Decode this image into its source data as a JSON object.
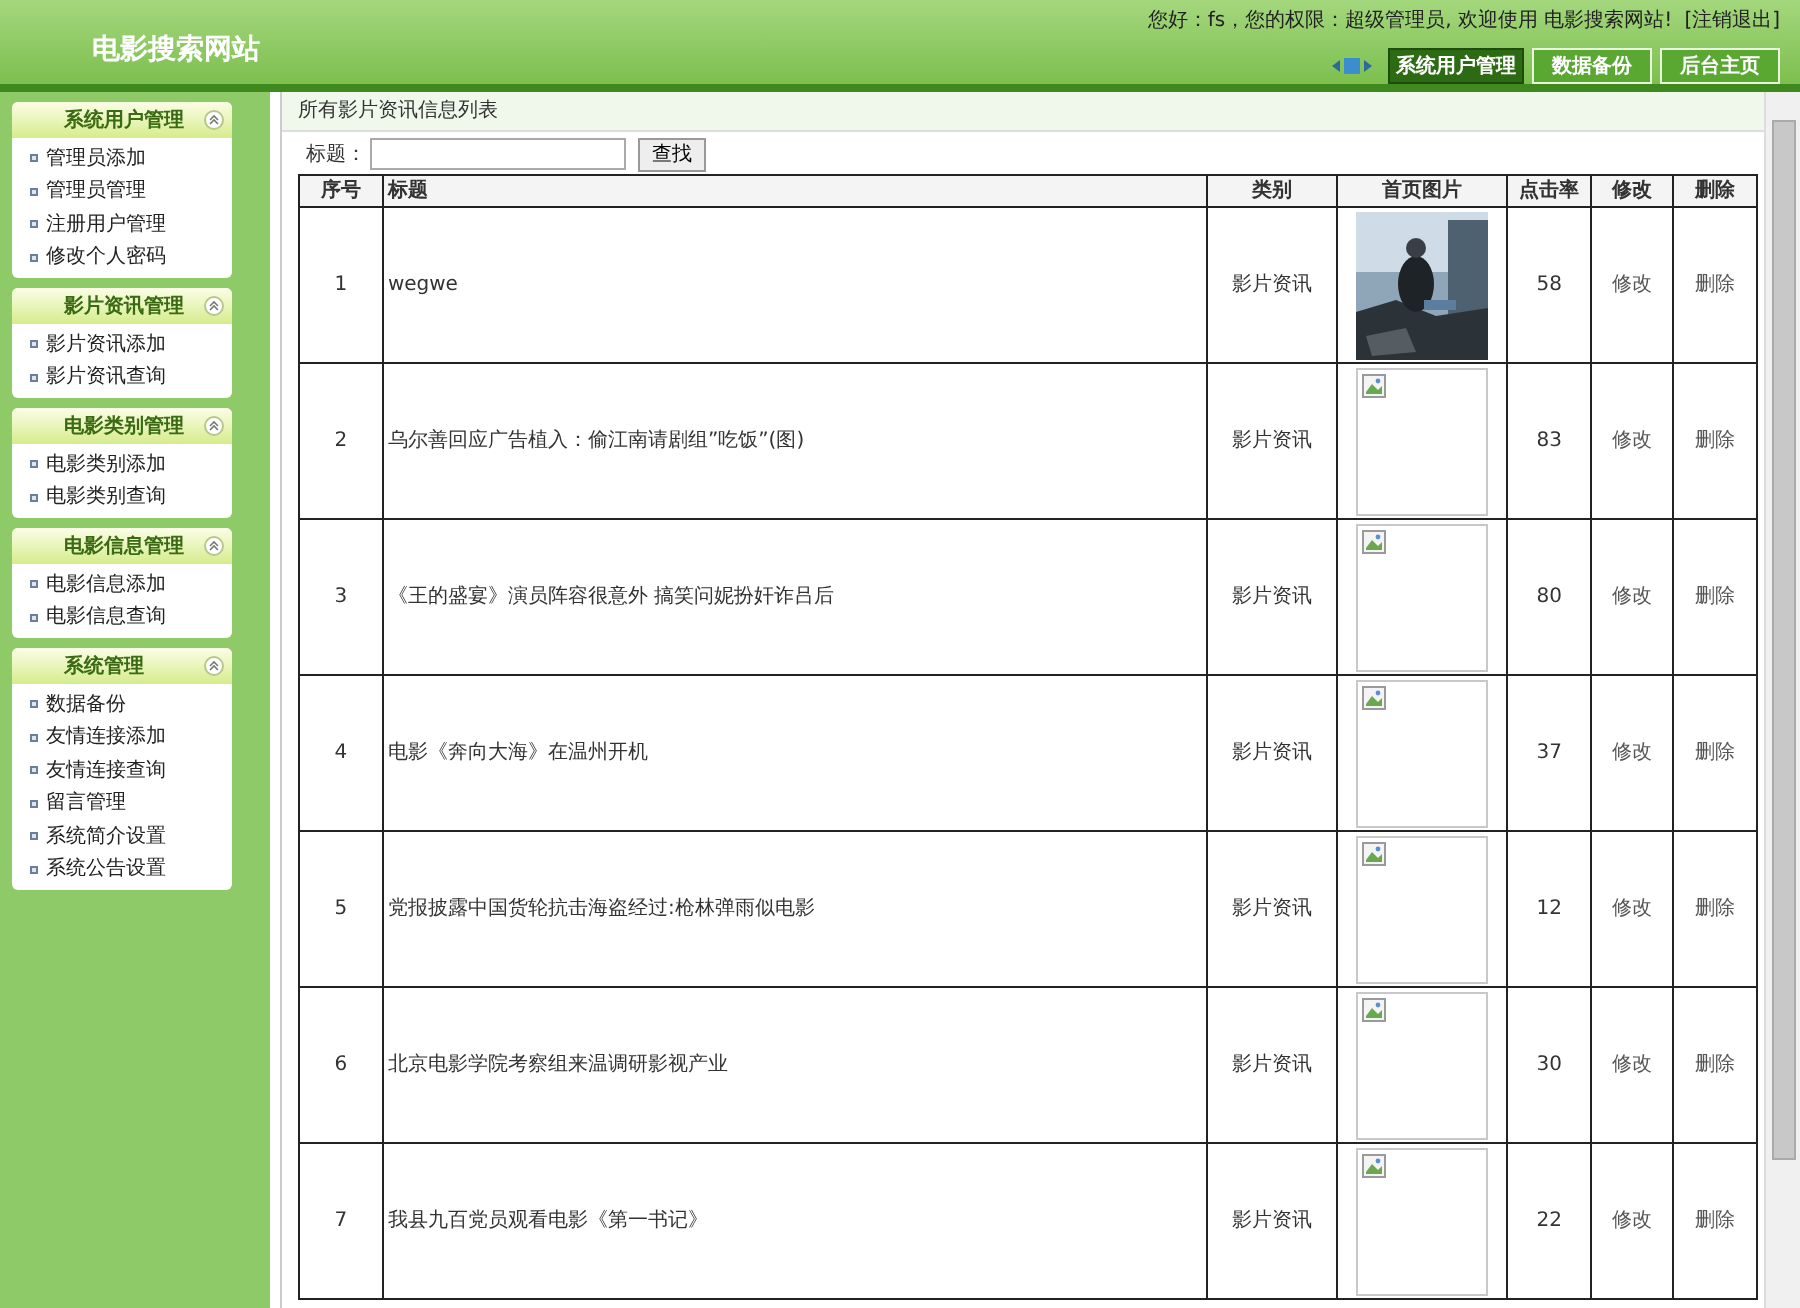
{
  "site_title": "电影搜索网站",
  "user_bar": {
    "text": "您好：fs，您的权限：超级管理员, 欢迎使用 电影搜索网站!",
    "logout": "[注销退出]"
  },
  "tabs": [
    {
      "label": "系统用户管理",
      "selected": true
    },
    {
      "label": "数据备份",
      "selected": false
    },
    {
      "label": "后台主页",
      "selected": false
    }
  ],
  "sidebar": [
    {
      "title": "系统用户管理",
      "items": [
        "管理员添加",
        "管理员管理",
        "注册用户管理",
        "修改个人密码"
      ]
    },
    {
      "title": "影片资讯管理",
      "items": [
        "影片资讯添加",
        "影片资讯查询"
      ]
    },
    {
      "title": "电影类别管理",
      "items": [
        "电影类别添加",
        "电影类别查询"
      ]
    },
    {
      "title": "电影信息管理",
      "items": [
        "电影信息添加",
        "电影信息查询"
      ]
    },
    {
      "title": "系统管理",
      "items": [
        "数据备份",
        "友情连接添加",
        "友情连接查询",
        "留言管理",
        "系统简介设置",
        "系统公告设置"
      ]
    }
  ],
  "page_caption": "所有影片资讯信息列表",
  "search": {
    "label": "标题：",
    "button": "查找"
  },
  "table": {
    "columns": [
      "序号",
      "标题",
      "类别",
      "首页图片",
      "点击率",
      "修改",
      "删除"
    ],
    "rows": [
      {
        "no": "1",
        "title": "wegwe",
        "category": "影片资讯",
        "clicks": "58",
        "edit": "修改",
        "delete": "删除"
      },
      {
        "no": "2",
        "title": "乌尔善回应广告植入：偷江南请剧组”吃饭”(图)",
        "category": "影片资讯",
        "image": {
          "kind": "broken"
        },
        "clicks": "83",
        "edit": "修改",
        "delete": "删除"
      },
      {
        "no": "3",
        "title": "《王的盛宴》演员阵容很意外 搞笑问妮扮奸诈吕后",
        "category": "影片资讯",
        "image": {
          "kind": "broken"
        },
        "clicks": "80",
        "edit": "修改",
        "delete": "删除"
      },
      {
        "no": "4",
        "title": "电影《奔向大海》在温州开机",
        "category": "影片资讯",
        "image": {
          "kind": "broken"
        },
        "clicks": "37",
        "edit": "修改",
        "delete": "删除"
      },
      {
        "no": "5",
        "title": "党报披露中国货轮抗击海盗经过:枪林弹雨似电影",
        "category": "影片资讯",
        "image": {
          "kind": "broken"
        },
        "clicks": "12",
        "edit": "修改",
        "delete": "删除"
      },
      {
        "no": "6",
        "title": "北京电影学院考察组来温调研影视产业",
        "category": "影片资讯",
        "image": {
          "kind": "broken"
        },
        "clicks": "30",
        "edit": "修改",
        "delete": "删除"
      },
      {
        "no": "7",
        "title": "我县九百党员观看电影《第一书记》",
        "category": "影片资讯",
        "image": {
          "kind": "broken"
        },
        "clicks": "22",
        "edit": "修改",
        "delete": "删除"
      }
    ]
  }
}
